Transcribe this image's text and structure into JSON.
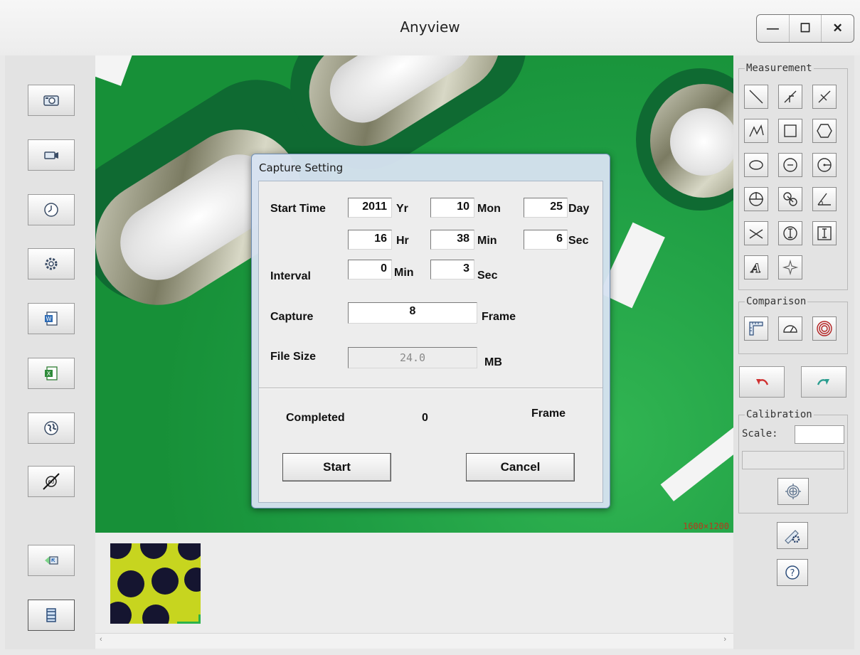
{
  "window": {
    "title": "Anyview",
    "minimize_label": "—",
    "maximize_label": "☐",
    "close_label": "✕"
  },
  "viewer": {
    "resolution_label": "1600×1200"
  },
  "right_panel": {
    "measurement_label": "Measurement",
    "comparison_label": "Comparison",
    "calibration_label": "Calibration",
    "scale_label": "Scale:",
    "scale_value": "",
    "calibration_value": ""
  },
  "dialog": {
    "title": "Capture Setting",
    "start_time_label": "Start Time",
    "year_value": "2011",
    "year_unit": "Yr",
    "month_value": "10",
    "month_unit": "Mon",
    "day_value": "25",
    "day_unit": "Day",
    "hour_value": "16",
    "hour_unit": "Hr",
    "minute_value": "38",
    "minute_unit": "Min",
    "second_value": "6",
    "second_unit": "Sec",
    "interval_label": "Interval",
    "interval_min_value": "0",
    "interval_min_unit": "Min",
    "interval_sec_value": "3",
    "interval_sec_unit": "Sec",
    "capture_label": "Capture",
    "capture_value": "8",
    "capture_unit": "Frame",
    "filesize_label": "File Size",
    "filesize_value": "24.0",
    "filesize_unit": "MB",
    "completed_label": "Completed",
    "completed_value": "0",
    "completed_unit": "Frame",
    "start_button": "Start",
    "cancel_button": "Cancel"
  },
  "colors": {
    "pcb_green": "#1e9b43",
    "resolution_text": "#b8381c",
    "undo_red": "#d03030",
    "redo_teal": "#2a9d8f"
  }
}
